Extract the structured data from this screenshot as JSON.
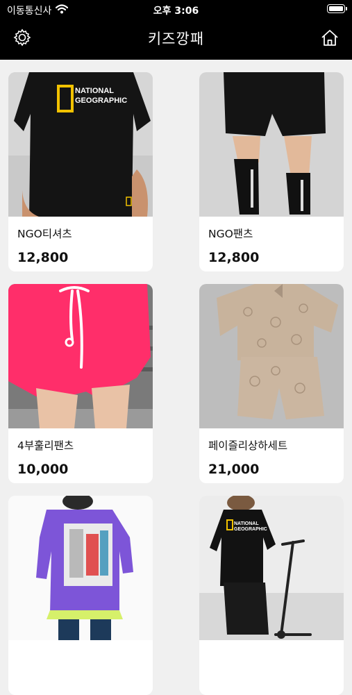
{
  "status": {
    "carrier": "이동통신사",
    "time": "오후 3:06"
  },
  "nav": {
    "title": "키즈깡패",
    "left_icon": "gear-icon",
    "right_icon": "home-icon"
  },
  "products": [
    {
      "name": "NGO티셔츠",
      "price": "12,800",
      "photo": {
        "brand_line1": "NATIONAL",
        "brand_line2": "GEOGRAPHIC"
      }
    },
    {
      "name": "NGO팬츠",
      "price": "12,800"
    },
    {
      "name": "4부훌리팬츠",
      "price": "10,000"
    },
    {
      "name": "페이즐리상하세트",
      "price": "21,000"
    },
    {
      "name": "",
      "price": ""
    },
    {
      "name": "",
      "price": "",
      "photo": {
        "brand_line1": "NATIONAL",
        "brand_line2": "GEOGRAPHIC"
      }
    }
  ],
  "colors": {
    "bar_bg": "#000000",
    "page_bg": "#f0f0f0",
    "card_bg": "#ffffff",
    "accent_yellow": "#f2c200"
  }
}
